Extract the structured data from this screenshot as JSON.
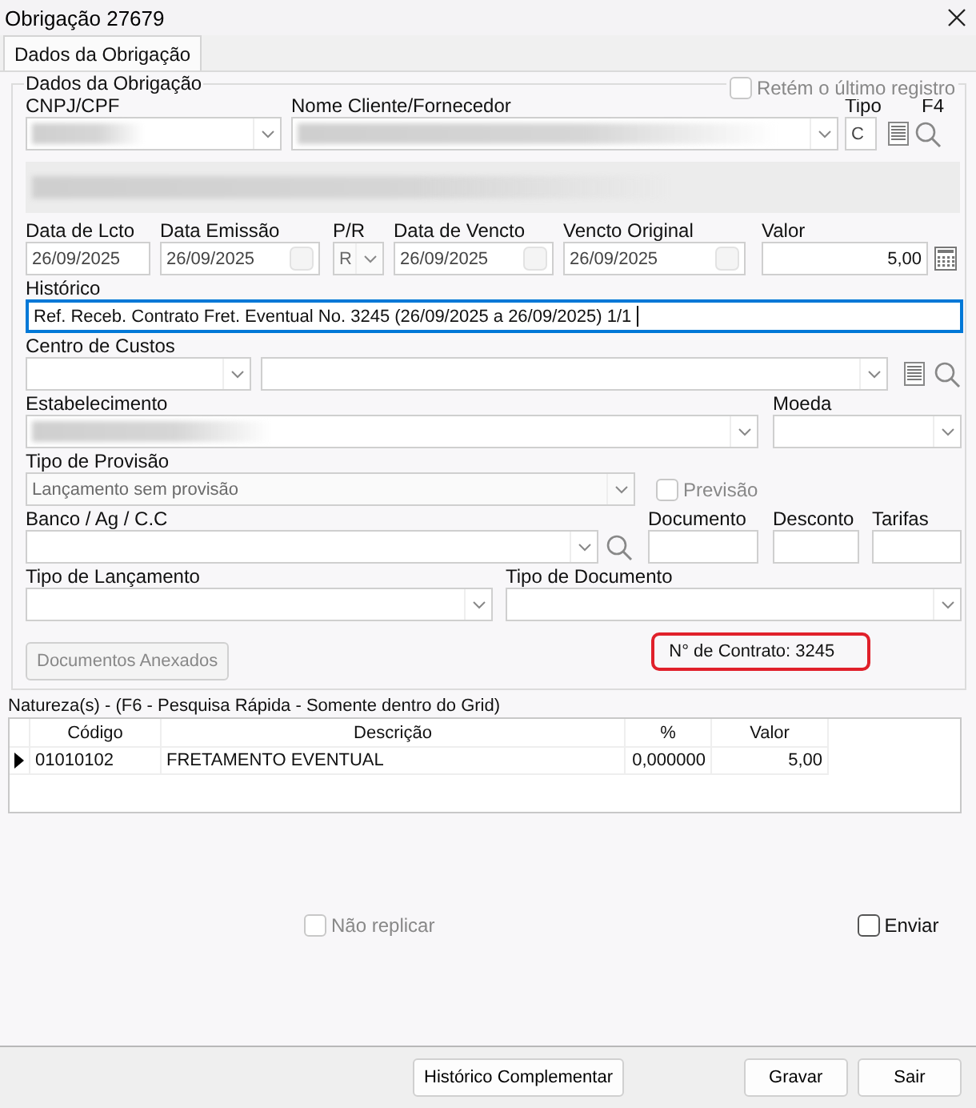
{
  "window": {
    "title": "Obrigação 27679"
  },
  "tabs": [
    {
      "label": "Dados da Obrigação",
      "selected": true
    }
  ],
  "group": {
    "title": "Dados da Obrigação",
    "retain": {
      "label": "Retém o último registro",
      "checked": false,
      "disabled": true
    }
  },
  "party": {
    "cnpj_label": "CNPJ/CPF",
    "name_label": "Nome Cliente/Fornecedor",
    "tipo_label": "Tipo",
    "tipo_value": "C",
    "f4_label": "F4",
    "redacted": true
  },
  "dates": [
    {
      "label": "Data de Lcto",
      "value": "26/09/2025",
      "kind": "text"
    },
    {
      "label": "Data Emissão",
      "value": "26/09/2025",
      "kind": "date"
    },
    {
      "label": "P/R",
      "value": "R",
      "kind": "combo"
    },
    {
      "label": "Data de Vencto",
      "value": "26/09/2025",
      "kind": "date"
    },
    {
      "label": "Vencto Original",
      "value": "26/09/2025",
      "kind": "date"
    },
    {
      "label": "Valor",
      "value": "5,00",
      "kind": "number"
    }
  ],
  "historico": {
    "label": "Histórico",
    "value": "Ref. Receb. Contrato Fret. Eventual No. 3245  (26/09/2025 a 26/09/2025) 1/1",
    "focused": true
  },
  "centro_custos": {
    "label": "Centro de Custos"
  },
  "estabelecimento": {
    "label": "Estabelecimento",
    "redacted": true
  },
  "moeda": {
    "label": "Moeda"
  },
  "provisao": {
    "label": "Tipo de Provisão",
    "value": "Lançamento sem provisão",
    "disabled": true,
    "previsao": {
      "label": "Previsão",
      "checked": false,
      "disabled": true
    }
  },
  "banco": {
    "label": "Banco / Ag / C.C"
  },
  "documento": {
    "label": "Documento"
  },
  "desconto": {
    "label": "Desconto"
  },
  "tarifas": {
    "label": "Tarifas"
  },
  "tipo_lancamento": {
    "label": "Tipo de Lançamento"
  },
  "tipo_documento": {
    "label": "Tipo de Documento"
  },
  "anexos_button": {
    "label": "Documentos Anexados",
    "disabled": true
  },
  "contract": {
    "text": "N° de Contrato: 3245"
  },
  "grid": {
    "title": "Natureza(s) - (F6 - Pesquisa Rápida - Somente dentro do Grid)",
    "columns": [
      "Código",
      "Descrição",
      "%",
      "Valor"
    ],
    "rows": [
      {
        "cells": [
          "01010102",
          "FRETAMENTO EVENTUAL",
          "0,000000",
          "5,00"
        ],
        "current": true
      }
    ]
  },
  "options": [
    {
      "label": "Não replicar",
      "checked": false,
      "disabled": true
    },
    {
      "label": "Enviar",
      "checked": false,
      "disabled": false
    }
  ],
  "buttons": [
    {
      "label": "Histórico Complementar",
      "kind": "left"
    },
    {
      "label": "Gravar",
      "kind": "right"
    },
    {
      "label": "Sair",
      "kind": "right"
    }
  ]
}
